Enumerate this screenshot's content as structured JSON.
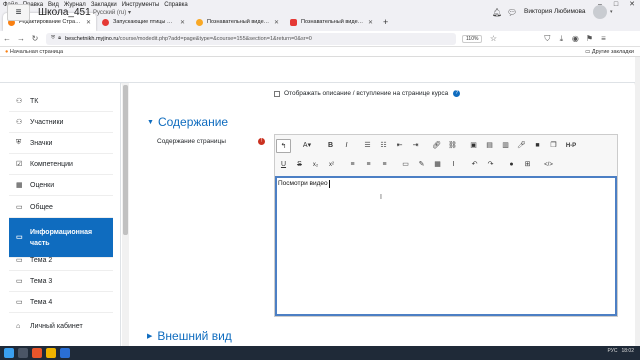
{
  "browser": {
    "menu": [
      "Файл",
      "Правка",
      "Вид",
      "Журнал",
      "Закладки",
      "Инструменты",
      "Справка"
    ],
    "tabs": [
      {
        "title": "Редактирование Страница",
        "color": "#f98012",
        "active": true
      },
      {
        "title": "Запускающие птицы — Яндекс.Видео",
        "color": "#e53935",
        "active": false
      },
      {
        "title": "Познавательный видеоролик",
        "color": "#f9a825",
        "active": false
      },
      {
        "title": "Познавательный видеоролик",
        "color": "#e53935",
        "active": false
      }
    ],
    "url_host": "beschetnikh.myjino.ru",
    "url_path": "/course/modedit.php?add=page&type=&course=155&section=1&return=0&sr=0",
    "zoom": "110%",
    "bookmark_left": "Начальная страница",
    "bookmark_right": "Другие закладки"
  },
  "navbar": {
    "site": "Школа_451",
    "lang": "Русский (ru)",
    "user": "Виктория Любимова"
  },
  "drawer": [
    {
      "label": "ТК",
      "icon": "users-icon"
    },
    {
      "label": "Участники",
      "icon": "users-icon"
    },
    {
      "label": "Значки",
      "icon": "shield-icon"
    },
    {
      "label": "Компетенции",
      "icon": "check-icon"
    },
    {
      "label": "Оценки",
      "icon": "table-icon"
    },
    {
      "label": "Общее",
      "icon": "folder-icon"
    },
    {
      "label": "Информационная часть",
      "icon": "folder-icon",
      "active": true
    },
    {
      "label": "Тема 2",
      "icon": "folder-icon"
    },
    {
      "label": "Тема 3",
      "icon": "folder-icon"
    },
    {
      "label": "Тема 4",
      "icon": "folder-icon"
    },
    {
      "label": "Личный кабинет",
      "icon": "home-icon"
    }
  ],
  "form": {
    "show_desc": "Отображать описание / вступление на странице курса",
    "section_content": "Содержание",
    "content_label": "Содержание страницы",
    "editor_text": "Посмотри видео",
    "section_appearance": "Внешний вид"
  },
  "taskbar": {
    "lang": "РУС",
    "time": "18:02"
  }
}
